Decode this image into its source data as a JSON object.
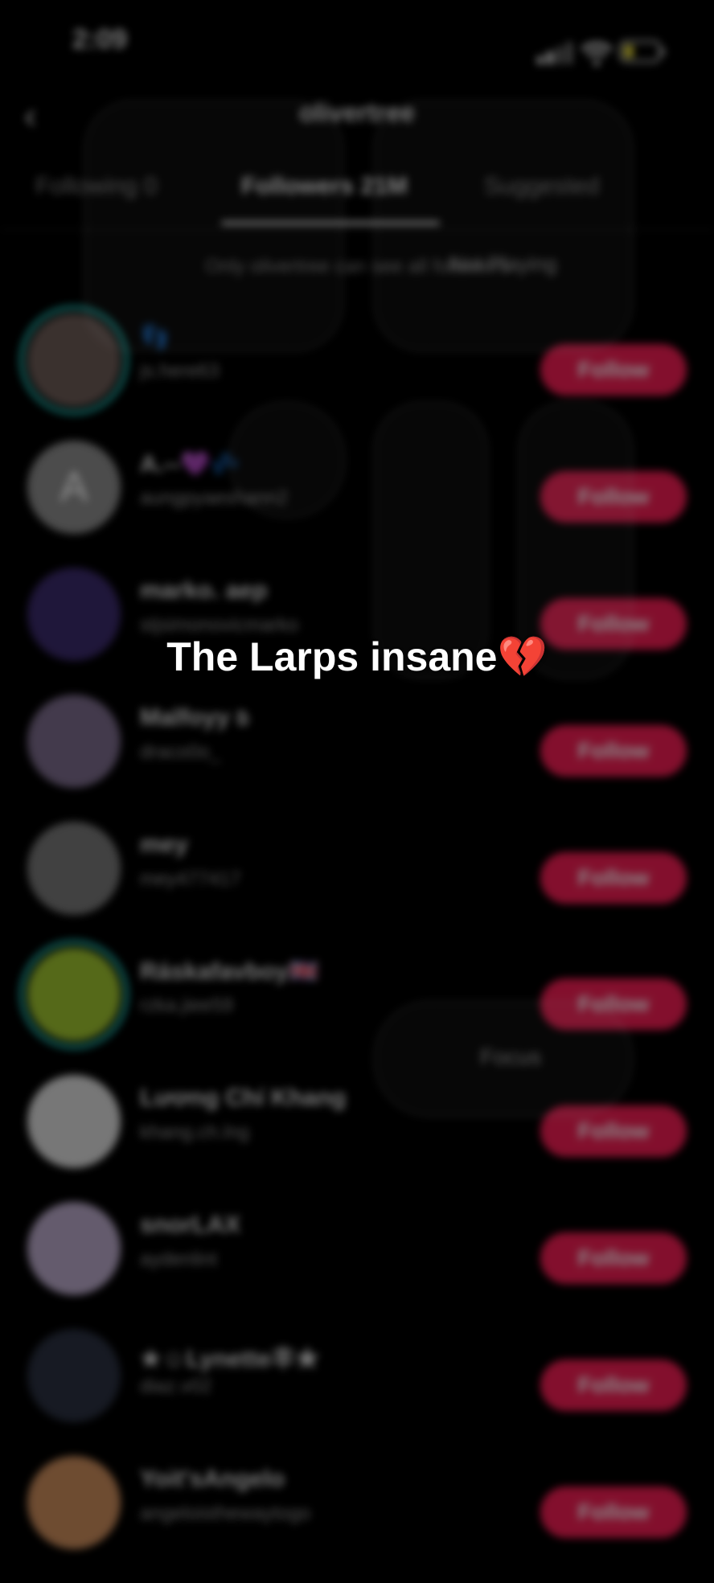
{
  "status_bar": {
    "time": "2:09"
  },
  "header": {
    "back_icon": "chevron-left-icon",
    "title": "olivertree"
  },
  "tabs": [
    {
      "label": "Following 0"
    },
    {
      "label": "Followers 21M"
    },
    {
      "label": "Suggested"
    }
  ],
  "notice": "Only olivertree can see all followers",
  "users": [
    {
      "name": "👣",
      "handle": "js.here63",
      "ring": true,
      "avatar_color": "#6b5a55"
    },
    {
      "name": "A.--💜💤",
      "handle": "aungpyaeshann2",
      "ring": false,
      "avatar_initial": "A",
      "avatar_color": "#8a8a8a"
    },
    {
      "name": "marko. aep",
      "handle": "stjsimonovicmarko",
      "ring": false,
      "avatar_color": "#3a2a6a"
    },
    {
      "name": "Malfoyy ಠಿ",
      "handle": "draco0o_",
      "ring": false,
      "avatar_color": "#7a6a8a"
    },
    {
      "name": "mey",
      "handle": "mey477417",
      "ring": false,
      "avatar_color": "#777"
    },
    {
      "name": "Ráskafavboy🇬🇧",
      "handle": "rzka.jiee59",
      "ring": true,
      "avatar_color": "#9bbf2f"
    },
    {
      "name": "Lương Chí Khang",
      "handle": "khang.ch.lng",
      "ring": false,
      "avatar_color": "#d9d9d9"
    },
    {
      "name": "snorLAX",
      "handle": "aydenlint",
      "ring": false,
      "avatar_color": "#b7a7c7"
    },
    {
      "name": "★☺Lynette丰★",
      "handle": "diaz.v02",
      "ring": false,
      "avatar_color": "#2a3040"
    },
    {
      "name": "Yoit'sAngelo",
      "handle": "angeloisthewaytogo",
      "ring": false,
      "avatar_color": "#c88a5a"
    }
  ],
  "follow_label": "Follow",
  "control_center": {
    "now_playing": "Not Playing",
    "focus": "Focus"
  },
  "caption": {
    "text": "The Larps insane",
    "emoji": "💔"
  }
}
